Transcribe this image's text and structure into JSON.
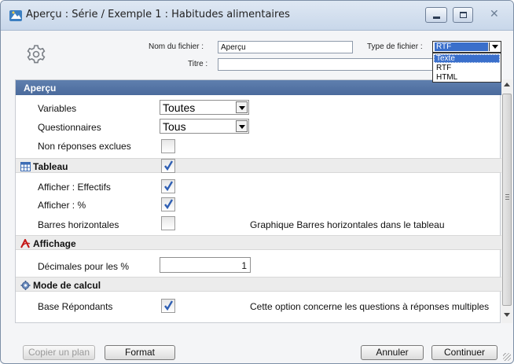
{
  "window": {
    "title": "Aperçu : Série / Exemple 1 : Habitudes alimentaires",
    "close_glyph": "✕"
  },
  "header": {
    "filename_label": "Nom du fichier :",
    "filename_value": "Aperçu",
    "title_label": "Titre :",
    "title_value": "",
    "filetype_label": "Type de fichier :",
    "filetype_value": "RTF",
    "filetype_options": [
      "Texte",
      "RTF",
      "HTML"
    ],
    "filetype_highlighted": "Texte"
  },
  "sections": {
    "apercu": {
      "title": "Aperçu",
      "variables_label": "Variables",
      "variables_value": "Toutes",
      "questionnaires_label": "Questionnaires",
      "questionnaires_value": "Tous",
      "nonreponses_label": "Non réponses exclues",
      "nonreponses_checked": false
    },
    "tableau": {
      "title": "Tableau",
      "checked": true,
      "effectifs_label": "Afficher : Effectifs",
      "effectifs_checked": true,
      "pourcent_label": "Afficher : %",
      "pourcent_checked": true,
      "barres_label": "Barres horizontales",
      "barres_checked": false,
      "barres_desc": "Graphique Barres horizontales dans le tableau"
    },
    "affichage": {
      "title": "Affichage",
      "decimales_label": "Décimales pour les %",
      "decimales_value": "1"
    },
    "mode_calcul": {
      "title": "Mode de calcul",
      "base_label": "Base Répondants",
      "base_checked": true,
      "base_desc": "Cette option concerne les questions à réponses multiples"
    }
  },
  "footer": {
    "copier_label": "Copier un plan",
    "format_label": "Format",
    "annuler_label": "Annuler",
    "continuer_label": "Continuer"
  },
  "colors": {
    "section_header": "#5f7fae",
    "selection": "#3a6fcb",
    "check": "#2f5fb3"
  }
}
